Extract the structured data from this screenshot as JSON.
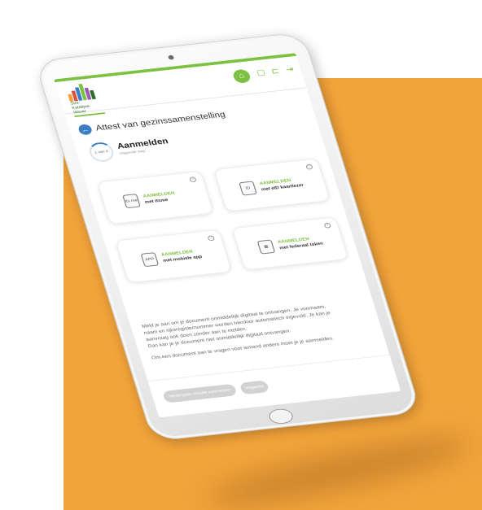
{
  "header": {
    "logo_text_1": "Sint-",
    "logo_text_2": "Katelijne-",
    "logo_text_3": "Waver"
  },
  "page": {
    "title": "Attest van gezinssamenstelling"
  },
  "step": {
    "counter": "1 van 4",
    "title": "Aanmelden",
    "subtitle": "Volgende stap: ..."
  },
  "login_options": [
    {
      "title": "AANMELDEN",
      "subtitle": "met itsme",
      "icon": "itsme-icon",
      "icon_label": "its me"
    },
    {
      "title": "AANMELDEN",
      "subtitle": "met eID kaartlezer",
      "icon": "card-reader-icon",
      "icon_label": "ID"
    },
    {
      "title": "AANMELDEN",
      "subtitle": "met mobiele app",
      "icon": "mobile-app-icon",
      "icon_label": "APP"
    },
    {
      "title": "AANMELDEN",
      "subtitle": "met federaal token",
      "icon": "token-icon",
      "icon_label": ""
    }
  ],
  "description": {
    "line1": "Meld je aan om je document onmiddellijk digitaal te ontvangen. Je voornaam,",
    "line2": "naam en rijksregisternummer worden hierdoor automatisch ingevuld. Je kan je",
    "line3": "aanvraag ook doen zonder aan te melden.",
    "line4": "Dan kan je je document niet onmiddellijk digitaal ontvangen.",
    "line5": "Om een document aan te vragen voor iemand anders moet je je aanmelden."
  },
  "buttons": {
    "continue_without_login": "Verdergaan zonder aanmelden",
    "next": "Volgende"
  },
  "colors": {
    "background_accent": "#f2a33a",
    "brand_green": "#7cc142",
    "primary_blue": "#3b7ec4"
  }
}
